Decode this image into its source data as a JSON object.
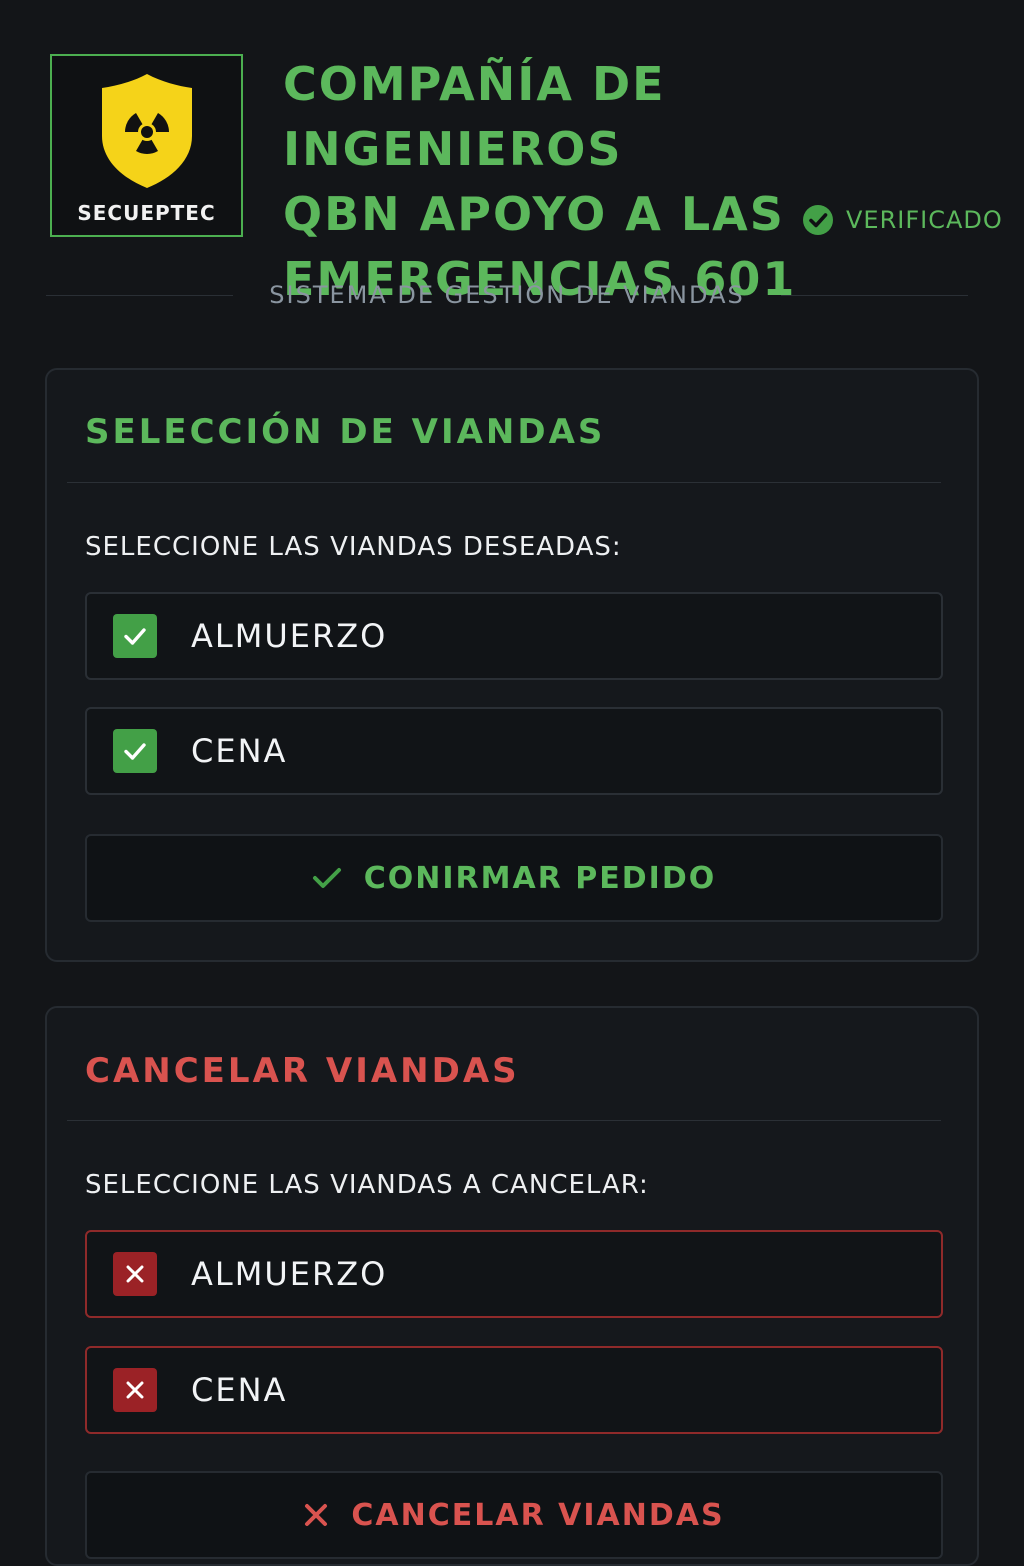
{
  "header": {
    "logo_text": "SECUEPTEC",
    "title_lines": [
      "COMPAÑÍA DE INGENIEROS",
      "QBN APOYO A LAS",
      "EMERGENCIAS 601"
    ],
    "verified_label": "VERIFICADO",
    "subtitle": "SISTEMA DE GESTIÓN DE VIANDAS"
  },
  "select_panel": {
    "title": "SELECCIÓN DE VIANDAS",
    "prompt": "SELECCIONE LAS VIANDAS DESEADAS:",
    "options": [
      {
        "label": "ALMUERZO",
        "checked": true
      },
      {
        "label": "CENA",
        "checked": true
      }
    ],
    "confirm_button": "CONIRMAR PEDIDO"
  },
  "cancel_panel": {
    "title": "CANCELAR VIANDAS",
    "prompt": "SELECCIONE LAS VIANDAS A CANCELAR:",
    "options": [
      {
        "label": "ALMUERZO",
        "marked": true
      },
      {
        "label": "CENA",
        "marked": true
      }
    ],
    "cancel_button": "CANCELAR VIANDAS"
  },
  "icons": {
    "logo": "radiation-shield-icon",
    "verified": "check-circle-icon",
    "checkbox_checked": "check-icon",
    "checkbox_cancel": "x-icon",
    "confirm": "check-icon",
    "cancel": "x-icon"
  },
  "colors": {
    "background": "#131518",
    "accent_green": "#5cb85c",
    "accent_red": "#d9534f",
    "shield_yellow": "#f5d319",
    "panel_border": "#262b31",
    "checkbox_green": "#43a047",
    "checkbox_red": "#9b2226",
    "option_cancel_border": "#8f2a2a"
  }
}
